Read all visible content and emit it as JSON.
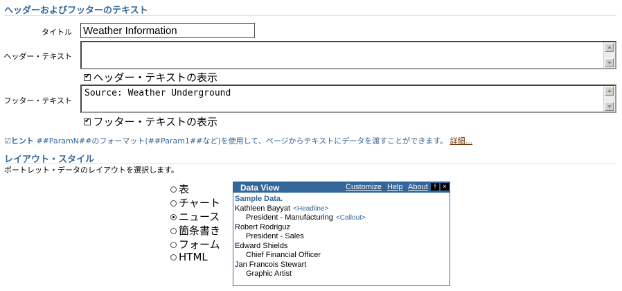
{
  "header_footer_section": {
    "title": "ヘッダーおよびフッターのテキスト",
    "title_label": "タイトル",
    "title_value": "Weather Information",
    "header_label": "ヘッダー・テキスト",
    "header_value": "",
    "show_header_label": "ヘッダー・テキストの表示",
    "footer_label": "フッター・テキスト",
    "footer_value": "Source: Weather Underground",
    "show_footer_label": "フッター・テキストの表示"
  },
  "hint": {
    "prefix": "ヒント",
    "text": "##ParamN##のフォーマット(##Param1##など)を使用して、ページからテキストにデータを渡すことができます。",
    "more_link": "詳細..."
  },
  "layout_section": {
    "title": "レイアウト・スタイル",
    "description": "ポートレット・データのレイアウトを選択します。",
    "options": [
      {
        "label": "表",
        "selected": false
      },
      {
        "label": "チャート",
        "selected": false
      },
      {
        "label": "ニュース",
        "selected": true
      },
      {
        "label": "箇条書き",
        "selected": false
      },
      {
        "label": "フォーム",
        "selected": false
      },
      {
        "label": "HTML",
        "selected": false
      }
    ]
  },
  "data_view": {
    "title": "Data View",
    "links": [
      "Customize",
      "Help",
      "About"
    ],
    "sample_label": "Sample Data.",
    "rows": [
      {
        "text": "Kathleen Bayyat",
        "tag": "<Headline>",
        "indent": false
      },
      {
        "text": "President - Manufacturing",
        "tag": "<Callout>",
        "indent": true
      },
      {
        "text": "Robert Rodriguz",
        "tag": "",
        "indent": false
      },
      {
        "text": "President - Sales",
        "tag": "",
        "indent": true
      },
      {
        "text": "Edward Shields",
        "tag": "",
        "indent": false
      },
      {
        "text": "Chief Financial Officer",
        "tag": "",
        "indent": true
      },
      {
        "text": "Jan Francois Stewart",
        "tag": "",
        "indent": false
      },
      {
        "text": "Graphic Artist",
        "tag": "",
        "indent": true
      }
    ]
  },
  "colors": {
    "accent": "#336699",
    "rule": "#e4e0c8",
    "link_more": "#663300"
  }
}
